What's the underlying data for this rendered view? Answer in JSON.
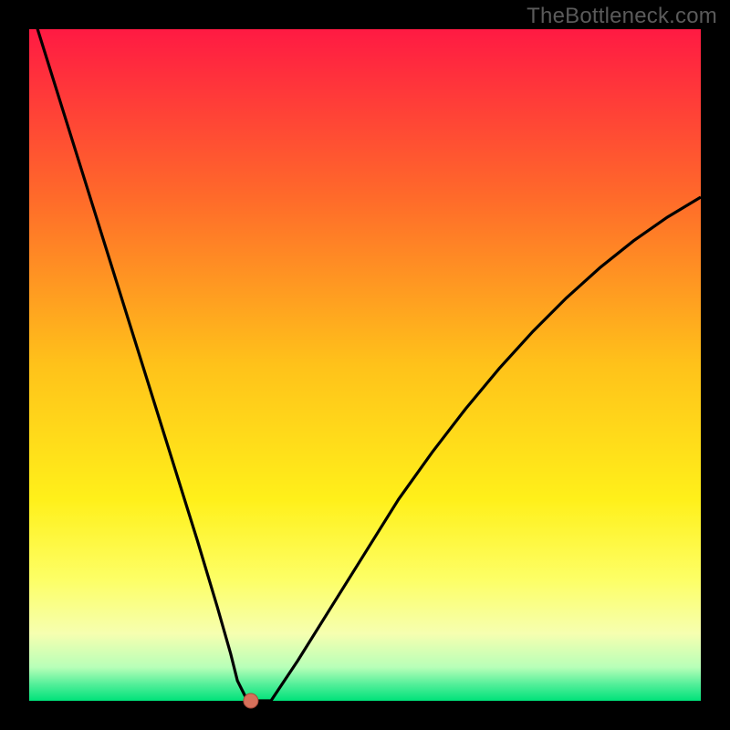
{
  "watermark": "TheBottleneck.com",
  "chart_data": {
    "type": "line",
    "title": "",
    "xlabel": "",
    "ylabel": "",
    "xlim": [
      0,
      100
    ],
    "ylim": [
      0,
      100
    ],
    "grid": false,
    "background": {
      "type": "vertical-gradient",
      "stops": [
        {
          "offset": 0.0,
          "color": "#ff1a43"
        },
        {
          "offset": 0.25,
          "color": "#ff6a2a"
        },
        {
          "offset": 0.5,
          "color": "#ffc21a"
        },
        {
          "offset": 0.7,
          "color": "#fff01a"
        },
        {
          "offset": 0.82,
          "color": "#fdff66"
        },
        {
          "offset": 0.9,
          "color": "#f6ffb0"
        },
        {
          "offset": 0.95,
          "color": "#b8ffb8"
        },
        {
          "offset": 0.975,
          "color": "#55ef9a"
        },
        {
          "offset": 1.0,
          "color": "#00e27a"
        }
      ]
    },
    "series": [
      {
        "name": "bottleneck-curve",
        "color": "#000000",
        "x": [
          0,
          5,
          10,
          15,
          20,
          25,
          28,
          30,
          31,
          32,
          32.5,
          34,
          36,
          40,
          45,
          50,
          55,
          60,
          65,
          70,
          75,
          80,
          85,
          90,
          95,
          100
        ],
        "y": [
          104,
          88,
          72,
          56,
          40,
          24,
          14,
          7,
          3,
          1,
          0,
          0,
          0,
          6,
          14,
          22,
          30,
          37,
          43.5,
          49.5,
          55,
          60,
          64.5,
          68.5,
          72,
          75
        ],
        "notes": "Left branch descends steeply and linearly from top-left to a flat minimum near x≈32–36; right branch rises concavely toward the upper-right, flattening as x→100."
      }
    ],
    "marker": {
      "name": "optimal-point",
      "x": 33,
      "y": 0,
      "color": "#d6705a",
      "radius_px": 8
    },
    "frame": {
      "color": "#000000",
      "thickness_px": 32
    }
  }
}
